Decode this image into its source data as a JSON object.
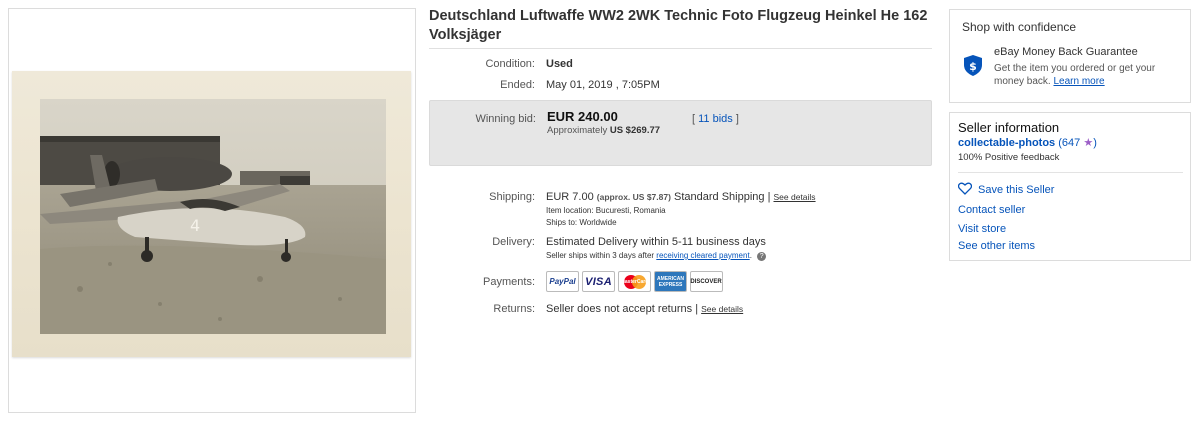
{
  "listing": {
    "title": "Deutschland Luftwaffe WW2 2WK Technic Foto Flugzeug Heinkel He 162 Volksjäger"
  },
  "image": {
    "number_on_plane": "4"
  },
  "details": {
    "condition_label": "Condition:",
    "condition_value": "Used",
    "ended_label": "Ended:",
    "ended_value": "May 01, 2019 , 7:05PM",
    "winning_bid_label": "Winning bid:",
    "winning_bid_price": "EUR 240.00",
    "approx_prefix": "Approximately",
    "approx_value": "US $269.77",
    "bids_prefix": "[ ",
    "bids_link": "11 bids",
    "bids_suffix": " ]",
    "shipping_label": "Shipping:",
    "shipping_price": "EUR 7.00",
    "shipping_approx": "(approx. US $7.87)",
    "shipping_method": "Standard Shipping |",
    "shipping_see_details": "See details",
    "item_location": "Item location:  Bucuresti, Romania",
    "ships_to": "Ships to:  Worldwide",
    "delivery_label": "Delivery:",
    "delivery_value": "Estimated Delivery within 5-11 business days",
    "delivery_sub_prefix": "Seller ships within 3 days after",
    "delivery_sub_link": "receiving cleared payment",
    "delivery_sub_suffix": ".",
    "help_icon": "?",
    "payments_label": "Payments:",
    "payment_cards": {
      "paypal": "PayPal",
      "visa": "VISA",
      "mastercard": "MasterCard",
      "amex": "AMERICAN EXPRESS",
      "discover": "DISCOVER"
    },
    "returns_label": "Returns:",
    "returns_value": "Seller does not accept returns |",
    "returns_see_details": "See details"
  },
  "shop_confidence": {
    "heading": "Shop with confidence",
    "guarantee_title": "eBay Money Back Guarantee",
    "guarantee_text": "Get the item you ordered or get your money back.",
    "learn_more": "Learn more"
  },
  "seller": {
    "heading": "Seller information",
    "name": "collectable-photos",
    "score_open": " (647 ",
    "score_close": ")",
    "star": "★",
    "feedback": "100% Positive feedback",
    "save_seller": "Save this Seller",
    "contact": "Contact seller",
    "visit_store": "Visit store",
    "see_other": "See other items"
  },
  "colors": {
    "link": "#0654ba",
    "bid_box_bg": "#e6e6e6",
    "shield": "#0654ba",
    "star": "#9c5fc7"
  }
}
